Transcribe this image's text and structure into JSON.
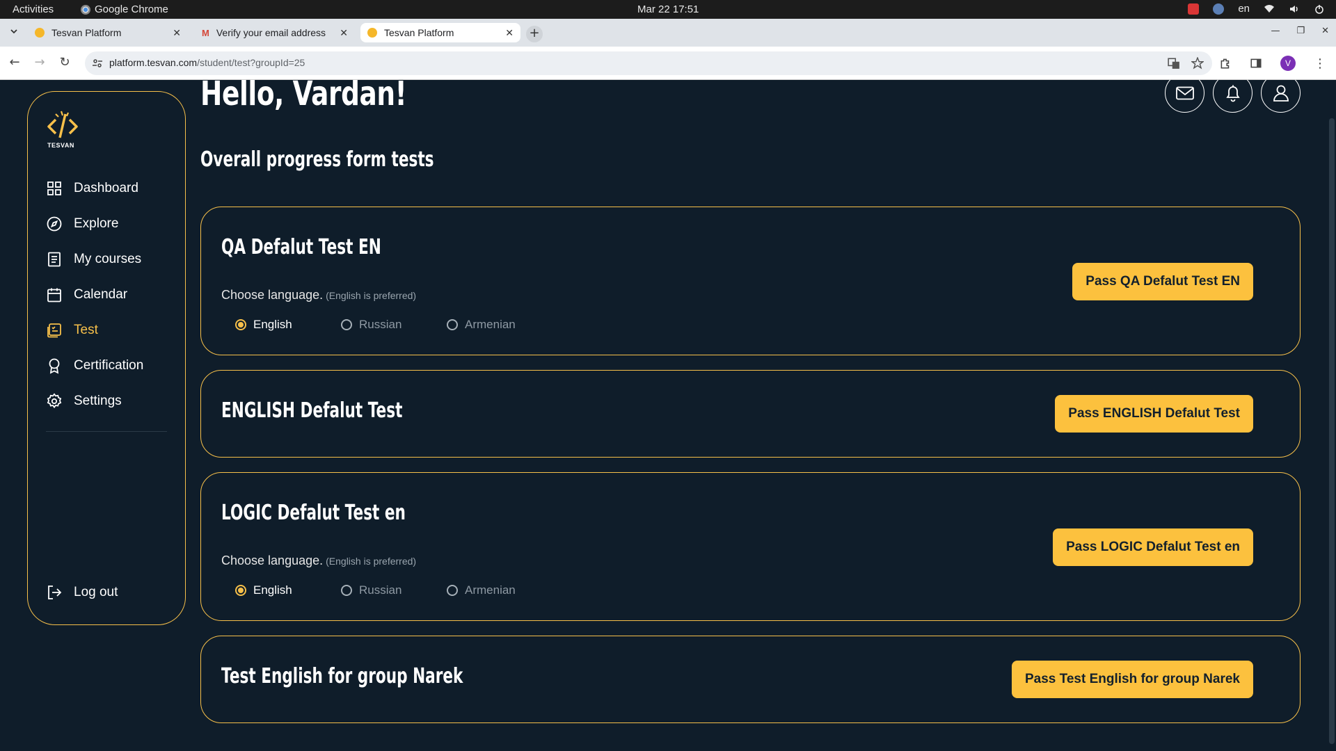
{
  "os": {
    "activities": "Activities",
    "app_name": "Google Chrome",
    "clock": "Mar 22  17:51",
    "lang": "en"
  },
  "tabs": [
    {
      "label": "Tesvan Platform",
      "favicon": "tesvan-favicon",
      "active": false
    },
    {
      "label": "Verify your email address",
      "favicon": "gmail-icon",
      "active": false
    },
    {
      "label": "Tesvan Platform",
      "favicon": "tesvan-favicon",
      "active": true
    }
  ],
  "new_tab": "+",
  "address": {
    "host": "platform.tesvan.com",
    "path": "/student/test?groupId=25"
  },
  "profile_initial": "V",
  "logo": {
    "text": "TESVAN"
  },
  "sidebar": {
    "items": [
      {
        "label": "Dashboard",
        "icon": "grid-icon",
        "active": false
      },
      {
        "label": "Explore",
        "icon": "compass-icon",
        "active": false
      },
      {
        "label": "My courses",
        "icon": "document-icon",
        "active": false
      },
      {
        "label": "Calendar",
        "icon": "calendar-icon",
        "active": false
      },
      {
        "label": "Test",
        "icon": "test-icon",
        "active": true
      },
      {
        "label": "Certification",
        "icon": "award-icon",
        "active": false
      },
      {
        "label": "Settings",
        "icon": "gear-icon",
        "active": false
      }
    ],
    "logout": "Log out"
  },
  "header": {
    "greeting": "Hello, Vardan!",
    "section_title": "Overall progress form tests"
  },
  "tests": [
    {
      "title": "QA Defalut Test EN",
      "has_language": true,
      "choose_label": "Choose language.",
      "choose_hint": "(English is preferred)",
      "languages": [
        "English",
        "Russian",
        "Armenian"
      ],
      "selected": "English",
      "button": "Pass QA Defalut Test EN"
    },
    {
      "title": "ENGLISH Defalut Test",
      "has_language": false,
      "button": "Pass ENGLISH Defalut Test"
    },
    {
      "title": "LOGIC Defalut Test en",
      "has_language": true,
      "choose_label": "Choose language.",
      "choose_hint": "(English is preferred)",
      "languages": [
        "English",
        "Russian",
        "Armenian"
      ],
      "selected": "English",
      "button": "Pass LOGIC Defalut Test en"
    },
    {
      "title": "Test English for group Narek",
      "has_language": false,
      "button": "Pass Test English for group Narek"
    }
  ],
  "colors": {
    "background": "#0f1d2a",
    "accent": "#f7c04a",
    "button": "#fcc13e"
  }
}
